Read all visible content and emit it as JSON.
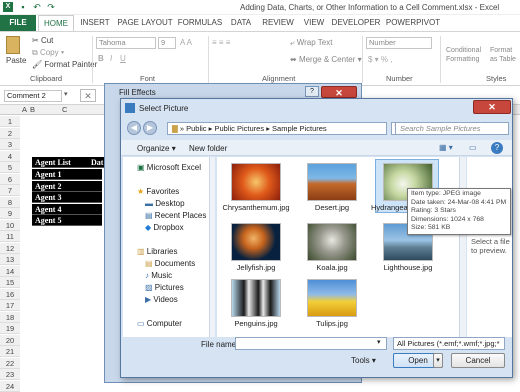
{
  "window": {
    "title": "Adding Data, Charts, or Other Information to a Cell Comment.xlsx - Excel"
  },
  "ribbon_tabs": [
    "FILE",
    "HOME",
    "INSERT",
    "PAGE LAYOUT",
    "FORMULAS",
    "DATA",
    "REVIEW",
    "VIEW",
    "DEVELOPER",
    "POWERPIVOT"
  ],
  "clipboard": {
    "cut": "Cut",
    "copy": "Copy",
    "paste": "Paste",
    "format_painter": "Format Painter",
    "group": "Clipboard"
  },
  "font": {
    "name": "Tahoma",
    "size": "9",
    "group": "Font"
  },
  "alignment": {
    "wrap": "Wrap Text",
    "merge": "Merge & Center",
    "group": "Alignment"
  },
  "number": {
    "format": "Number",
    "group": "Number"
  },
  "styles": {
    "cond": "Conditional Formatting",
    "table": "Format as Table",
    "group": "Styles"
  },
  "formula_bar": {
    "name_box": "Comment 2"
  },
  "sheet": {
    "cols": [
      "A",
      "B",
      "C"
    ],
    "rows": [
      "1",
      "2",
      "3",
      "4",
      "5",
      "6",
      "7",
      "8",
      "9",
      "10",
      "11",
      "12",
      "13",
      "14",
      "15",
      "16",
      "17",
      "18",
      "19",
      "20",
      "21",
      "22",
      "23",
      "24"
    ],
    "header_agent": "Agent List",
    "header_date": "Dat",
    "agents": [
      "Agent 1",
      "Agent 2",
      "Agent 3",
      "Agent 4",
      "Agent 5"
    ]
  },
  "fill_effects": {
    "title": "Fill Effects"
  },
  "dialog": {
    "title": "Select Picture",
    "breadcrumb": [
      "Public",
      "Public Pictures",
      "Sample Pictures"
    ],
    "search_placeholder": "Search Sample Pictures",
    "organize": "Organize",
    "new_folder": "New folder",
    "nav": {
      "excel": "Microsoft Excel",
      "favorites": "Favorites",
      "fav_items": [
        "Desktop",
        "Recent Places",
        "Dropbox"
      ],
      "libraries": "Libraries",
      "lib_items": [
        "Documents",
        "Music",
        "Pictures",
        "Videos"
      ],
      "computer": "Computer"
    },
    "files": [
      "Chrysanthemum.jpg",
      "Desert.jpg",
      "Hydrangeas.jpg",
      "Jellyfish.jpg",
      "Koala.jpg",
      "Lighthouse.jpg",
      "Penguins.jpg",
      "Tulips.jpg"
    ],
    "tooltip": [
      "Item type: JPEG image",
      "Date taken: 24-Mar-08 4:41 PM",
      "Rating: 3 Stars",
      "Dimensions: 1024 x 768",
      "Size: 581 KB"
    ],
    "preview_hint": "Select a file to preview.",
    "file_name_label": "File name:",
    "filter": "All Pictures (*.emf;*.wmf;*.jpg;*",
    "tools": "Tools",
    "open": "Open",
    "cancel": "Cancel"
  }
}
